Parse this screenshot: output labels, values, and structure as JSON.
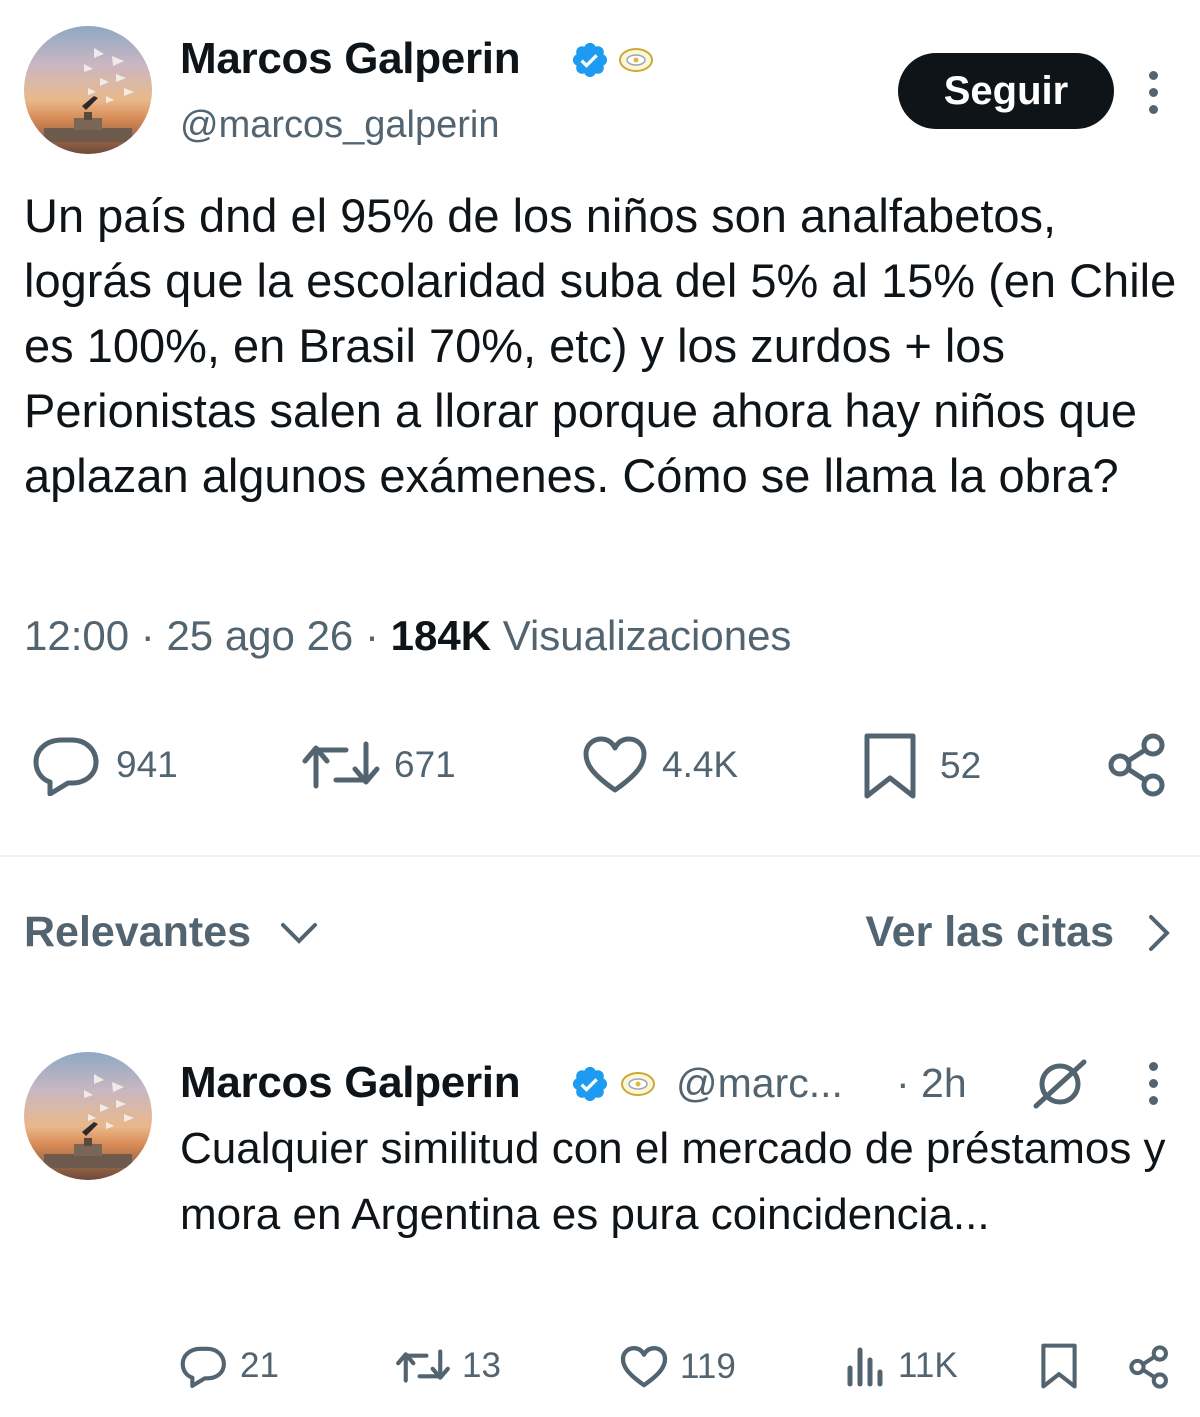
{
  "tweet": {
    "author_name": "Marcos Galperin",
    "handle": "@marcos_galperin",
    "follow_label": "Seguir",
    "text": "Un país dnd el 95% de los niños son analfabetos, lográs que la escolaridad suba del 5% al 15% (en Chile es 100%, en Brasil 70%, etc) y los zurdos + los Perionistas salen a llorar porque ahora hay niños que aplazan algunos exámenes. Cómo se llama la obra?",
    "time": "12:00",
    "date": "25 ago 26",
    "views_count": "184K",
    "views_label": "Visualizaciones",
    "replies": "941",
    "reposts": "671",
    "likes": "4.4K",
    "bookmarks": "52"
  },
  "sort_bar": {
    "sort_label": "Relevantes",
    "quotes_label": "Ver las citas"
  },
  "reply": {
    "author_name": "Marcos Galperin",
    "handle": "@marc...",
    "time": "· 2h",
    "text": "Cualquier similitud con el mercado de préstamos y mora en Argentina es pura coincidencia...",
    "replies": "21",
    "reposts": "13",
    "likes": "119",
    "views": "11K"
  },
  "icons": {
    "verified": "verified-badge-icon",
    "gov": "gov-label-icon",
    "more": "more-vertical-icon",
    "reply": "reply-bubble-icon",
    "repost": "repost-icon",
    "like": "heart-icon",
    "bookmark": "bookmark-icon",
    "share": "share-icon",
    "chevron_down": "chevron-down-icon",
    "chevron_right": "chevron-right-icon",
    "grok": "grok-icon",
    "views": "views-icon"
  },
  "colors": {
    "text": "#0f1419",
    "secondary": "#536471",
    "verified": "#1d9bf0",
    "button_bg": "#0f1419"
  }
}
